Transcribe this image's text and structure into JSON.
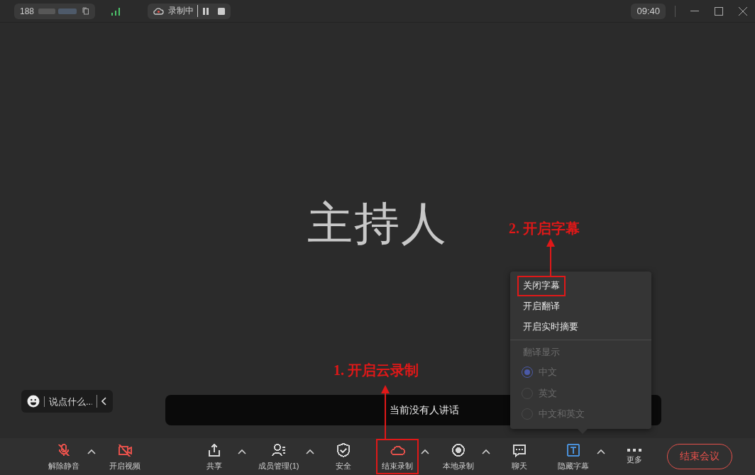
{
  "top_bar": {
    "meeting_id": "188",
    "recording": {
      "label": "录制中"
    },
    "time": "09:40"
  },
  "host_name": "主持人",
  "chat": {
    "placeholder": "说点什么..."
  },
  "caption": "当前没有人讲话",
  "caption_menu": {
    "items": [
      {
        "label": "关闭字幕",
        "highlighted": true
      },
      {
        "label": "开启翻译",
        "highlighted": false
      },
      {
        "label": "开启实时摘要",
        "highlighted": false
      }
    ],
    "section_title": "翻译显示",
    "options": [
      {
        "label": "中文",
        "selected": true,
        "disabled": true
      },
      {
        "label": "英文",
        "selected": false,
        "disabled": true
      },
      {
        "label": "中文和英文",
        "selected": false,
        "disabled": true
      }
    ]
  },
  "toolbar": {
    "items": [
      {
        "kind": "mic-off",
        "label": "解除静音",
        "color": "#e5514b",
        "has_caret": true,
        "highlighted": false
      },
      {
        "kind": "video-off",
        "label": "开启视频",
        "color": "#e5514b",
        "has_caret": false,
        "highlighted": false
      },
      {
        "kind": "gap"
      },
      {
        "kind": "share",
        "label": "共享",
        "color": "#d6d6d6",
        "has_caret": true,
        "highlighted": false
      },
      {
        "kind": "members",
        "label": "成员管理(1)",
        "color": "#d6d6d6",
        "has_caret": true,
        "highlighted": false
      },
      {
        "kind": "security",
        "label": "安全",
        "color": "#d6d6d6",
        "has_caret": false,
        "highlighted": false
      },
      {
        "kind": "cloud",
        "label": "结束录制",
        "color": "#e5514b",
        "has_caret": true,
        "highlighted": true
      },
      {
        "kind": "record",
        "label": "本地录制",
        "color": "#d6d6d6",
        "has_caret": true,
        "highlighted": false
      },
      {
        "kind": "chat",
        "label": "聊天",
        "color": "#d6d6d6",
        "has_caret": false,
        "highlighted": false
      },
      {
        "kind": "subtitle",
        "label": "隐藏字幕",
        "color": "#4a90d9",
        "has_caret": true,
        "highlighted": false
      },
      {
        "kind": "more",
        "label": "更多",
        "color": "#d6d6d6",
        "has_caret": false,
        "highlighted": false
      }
    ],
    "end_button": "结束会议"
  },
  "annotations": [
    {
      "label": "1. 开启云录制"
    },
    {
      "label": "2. 开启字幕"
    }
  ]
}
